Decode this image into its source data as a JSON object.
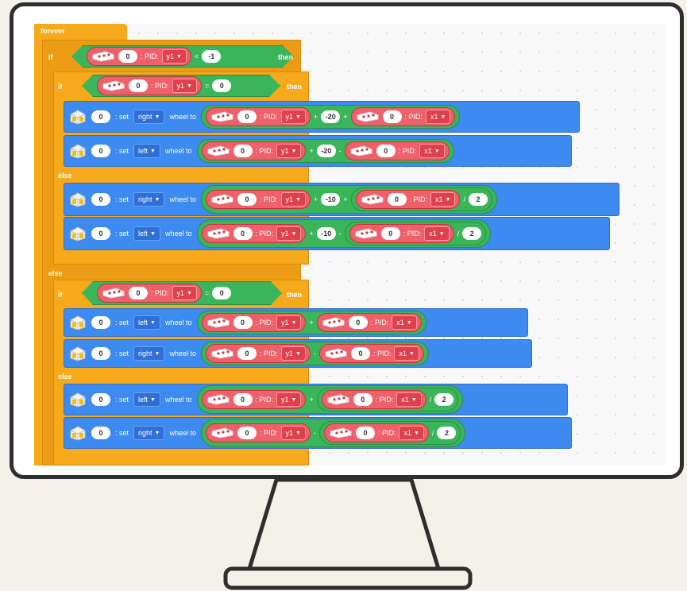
{
  "labels": {
    "forever": "forever",
    "if": "if",
    "then": "then",
    "else": "else"
  },
  "tokens": {
    "pid": ": PID:",
    "set": ": set",
    "wheel_to": "wheel to",
    "port": "0",
    "y1": "y1",
    "x1": "x1",
    "right": "right",
    "left": "left",
    "plus": "+",
    "minus": "-",
    "div": "/",
    "lt": "<",
    "eq": "=",
    "zero": "0",
    "neg1": "-1",
    "neg20": "-20",
    "neg10": "-10",
    "two": "2"
  },
  "icons": {
    "sensor": "color-sensor-icon",
    "robot": "robot-wheel-icon",
    "dropdown": "caret-down-icon"
  },
  "colors": {
    "control": "#f6a91b",
    "motion": "#3d8af0",
    "operator": "#3ab55a",
    "sensor": "#f0606a"
  }
}
